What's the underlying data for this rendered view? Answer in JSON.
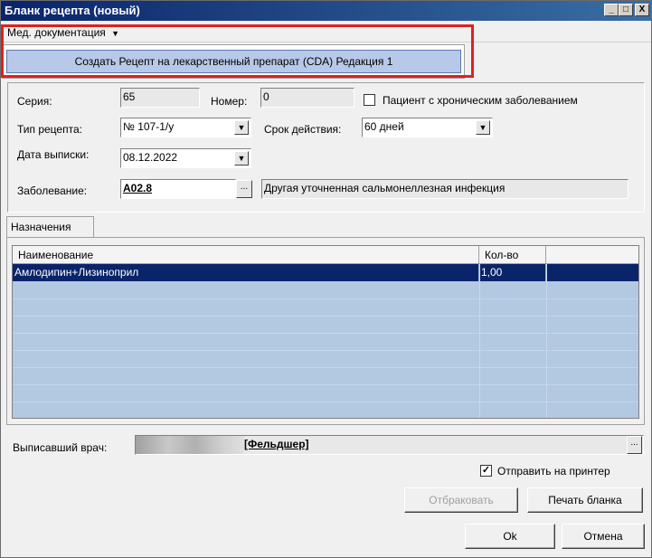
{
  "window": {
    "title": "Бланк рецепта (новый)"
  },
  "menu": {
    "med_docs": "Мед. документация",
    "dropdown_item": "Создать Рецепт на лекарственный препарат (CDA) Редакция 1"
  },
  "form": {
    "series_label": "Серия:",
    "series_value": "65",
    "number_label": "Номер:",
    "number_value": "0",
    "chronic_label": "Пациент с хроническим заболеванием",
    "type_label": "Тип рецепта:",
    "type_value": "№ 107-1/у",
    "validity_label": "Срок действия:",
    "validity_value": "60 дней",
    "date_label": "Дата выписки:",
    "date_value": "08.12.2022",
    "disease_label": "Заболевание:",
    "disease_code": "A02.8",
    "disease_name": "Другая уточненная сальмонеллезная инфекция",
    "dots": "..."
  },
  "tabs": {
    "assignments": "Назначения"
  },
  "grid": {
    "headers": [
      "Наименование",
      "Кол-во"
    ],
    "rows": [
      {
        "name": "Амлодипин+Лизиноприл",
        "qty": "1,00"
      }
    ]
  },
  "doctor": {
    "label": "Выписавший врач:",
    "role": "[Фельдшер]"
  },
  "print": {
    "send_label": "Отправить на принтер",
    "checked": true
  },
  "buttons": {
    "reject": "Отбраковать",
    "print_form": "Печать бланка",
    "ok": "Ok",
    "cancel": "Отмена"
  },
  "window_controls": {
    "minimize": "_",
    "maximize": "□",
    "close": "X"
  }
}
